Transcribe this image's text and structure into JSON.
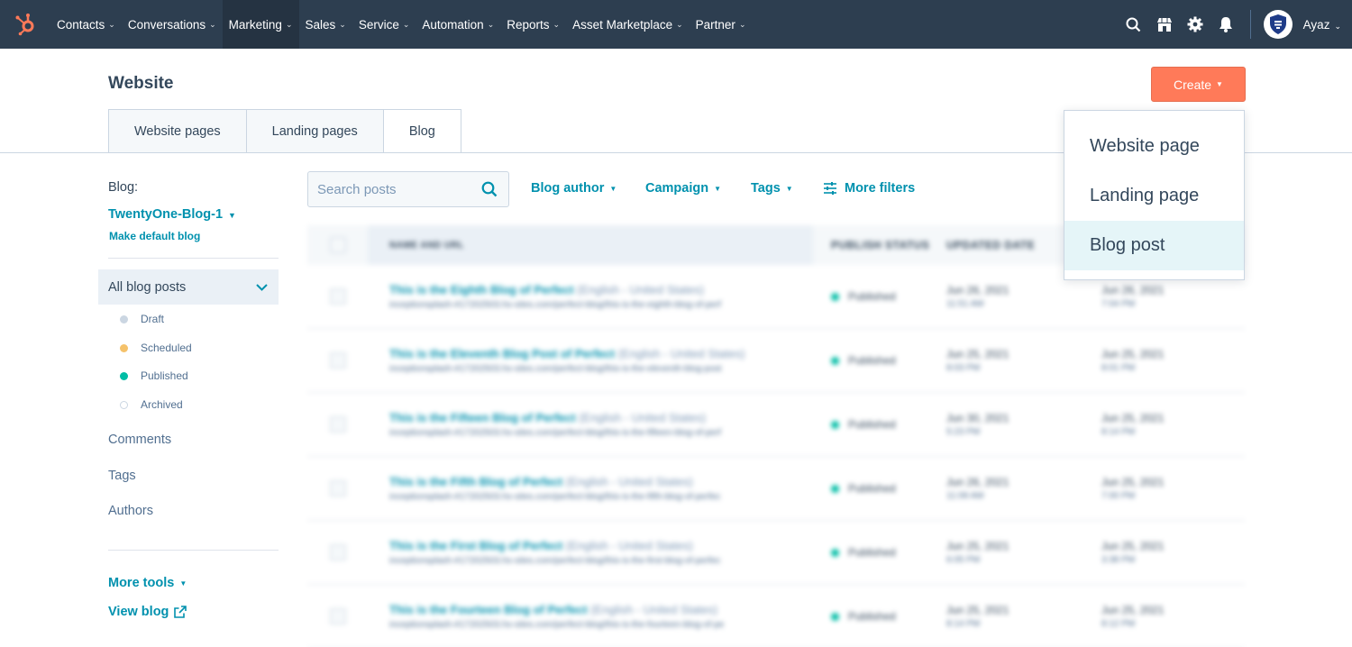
{
  "topnav": {
    "items": [
      {
        "label": "Contacts"
      },
      {
        "label": "Conversations"
      },
      {
        "label": "Marketing"
      },
      {
        "label": "Sales"
      },
      {
        "label": "Service"
      },
      {
        "label": "Automation"
      },
      {
        "label": "Reports"
      },
      {
        "label": "Asset Marketplace"
      },
      {
        "label": "Partner"
      }
    ],
    "active": "Marketing",
    "user_name": "Ayaz",
    "icons": [
      "search-icon",
      "marketplace-icon",
      "settings-icon",
      "notifications-icon"
    ]
  },
  "header": {
    "title": "Website",
    "tabs": [
      {
        "label": "Website pages"
      },
      {
        "label": "Landing pages"
      },
      {
        "label": "Blog"
      }
    ],
    "selected_tab": "Blog",
    "create_label": "Create"
  },
  "create_menu": {
    "items": [
      {
        "label": "Website page"
      },
      {
        "label": "Landing page"
      },
      {
        "label": "Blog post"
      }
    ],
    "highlighted": "Blog post"
  },
  "sidebar": {
    "blog_label": "Blog:",
    "blog_name": "TwentyOne-Blog-1",
    "make_default": "Make default blog",
    "all_posts": "All blog posts",
    "statuses": [
      {
        "label": "Draft",
        "color": "#cbd6e2"
      },
      {
        "label": "Scheduled",
        "color": "#f5c26b"
      },
      {
        "label": "Published",
        "color": "#00bda5"
      },
      {
        "label": "Archived",
        "color": "#ffffff"
      }
    ],
    "links": [
      {
        "label": "Comments"
      },
      {
        "label": "Tags"
      },
      {
        "label": "Authors"
      }
    ],
    "more_tools": "More tools",
    "view_blog": "View blog"
  },
  "filters": {
    "search_placeholder": "Search posts",
    "blog_author": "Blog author",
    "campaign": "Campaign",
    "tags": "Tags",
    "more_filters": "More filters"
  },
  "table": {
    "columns": [
      "NAME AND URL",
      "PUBLISH STATUS",
      "UPDATED DATE",
      ""
    ],
    "rows": [
      {
        "title": "This is the Eighth Blog of Perfect",
        "lang": "(English - United States)",
        "url": "inceptionsplash-#17202503.hs-sites.com/perfect-blog/this-is-the-eighth-blog-of-perf",
        "status": "Published",
        "updated": "Jun 26, 2021",
        "updated_time": "11:51 AM",
        "date2": "Jun 26, 2021",
        "date2_time": "7:04 PM"
      },
      {
        "title": "This is the Eleventh Blog Post of Perfect",
        "lang": "(English - United States)",
        "url": "inceptionsplash-#17202503.hs-sites.com/perfect-blog/this-is-the-eleventh-blog-post",
        "status": "Published",
        "updated": "Jun 25, 2021",
        "updated_time": "8:03 PM",
        "date2": "Jun 25, 2021",
        "date2_time": "8:01 PM"
      },
      {
        "title": "This is the Fifteen Blog of Perfect",
        "lang": "(English - United States)",
        "url": "inceptionsplash-#17202503.hs-sites.com/perfect-blog/this-is-the-fifteen-blog-of-perf",
        "status": "Published",
        "updated": "Jun 30, 2021",
        "updated_time": "5:23 PM",
        "date2": "Jun 25, 2021",
        "date2_time": "8:14 PM"
      },
      {
        "title": "This is the Fifth Blog of Perfect",
        "lang": "(English - United States)",
        "url": "inceptionsplash-#17202503.hs-sites.com/perfect-blog/this-is-the-fifth-blog-of-perfec",
        "status": "Published",
        "updated": "Jun 26, 2021",
        "updated_time": "11:08 AM",
        "date2": "Jun 25, 2021",
        "date2_time": "7:00 PM"
      },
      {
        "title": "This is the First Blog of Perfect",
        "lang": "(English - United States)",
        "url": "inceptionsplash-#17202503.hs-sites.com/perfect-blog/this-is-the-first-blog-of-perfec",
        "status": "Published",
        "updated": "Jun 25, 2021",
        "updated_time": "6:05 PM",
        "date2": "Jun 25, 2021",
        "date2_time": "3:38 PM"
      },
      {
        "title": "This is the Fourteen Blog of Perfect",
        "lang": "(English - United States)",
        "url": "inceptionsplash-#17202503.hs-sites.com/perfect-blog/this-is-the-fourteen-blog-of-pe",
        "status": "Published",
        "updated": "Jun 25, 2021",
        "updated_time": "8:14 PM",
        "date2": "Jun 25, 2021",
        "date2_time": "8:12 PM"
      }
    ]
  },
  "colors": {
    "nav_bg": "#2d3e50",
    "accent_link": "#0091ae",
    "create_button": "#ff7a59",
    "published_dot": "#00bda5"
  }
}
